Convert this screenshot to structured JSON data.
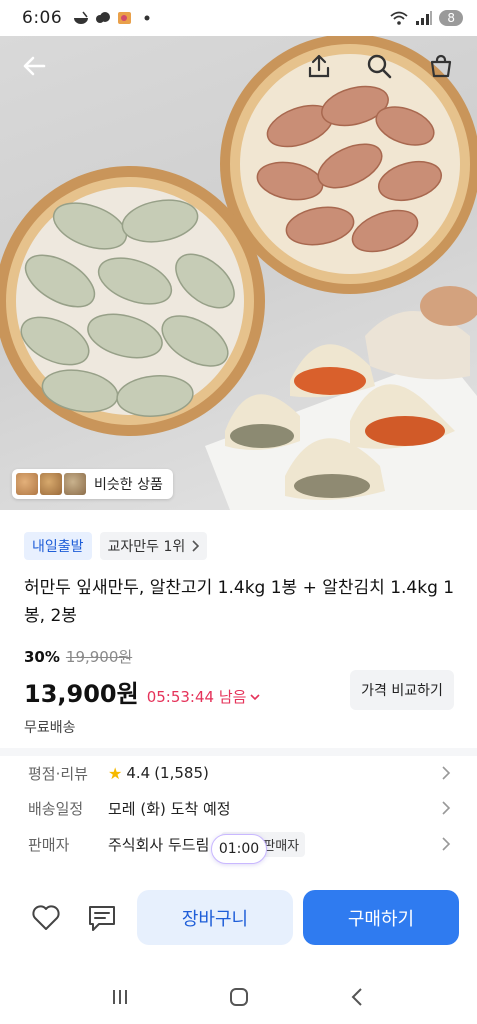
{
  "status_bar": {
    "time": "6:06",
    "battery": "8"
  },
  "hero": {
    "similar_label": "비슷한 상품"
  },
  "tags": {
    "delivery": "내일출발",
    "ranking": "교자만두 1위"
  },
  "product": {
    "title": "허만두 잎새만두, 알찬고기 1.4kg 1봉 + 알찬김치 1.4kg 1봉, 2봉",
    "discount_rate": "30%",
    "original_price": "19,900원",
    "price": "13,900원",
    "countdown": "05:53:44 남음",
    "compare_label": "가격 비교하기",
    "shipping": "무료배송"
  },
  "info": {
    "rating_key": "평점·리뷰",
    "rating_value": "4.4",
    "review_count": "(1,585)",
    "delivery_key": "배송일정",
    "delivery_value": "모레 (화) 도착 예정",
    "seller_key": "판매자",
    "seller_value": "주식회사 두드림",
    "seller_badge": "베스트판매자"
  },
  "overlay_timer": "01:00",
  "bottom_bar": {
    "cart_label": "장바구니",
    "buy_label": "구매하기"
  },
  "colors": {
    "accent": "#2f7bf0",
    "countdown": "#e5335a",
    "star": "#f6b900"
  }
}
